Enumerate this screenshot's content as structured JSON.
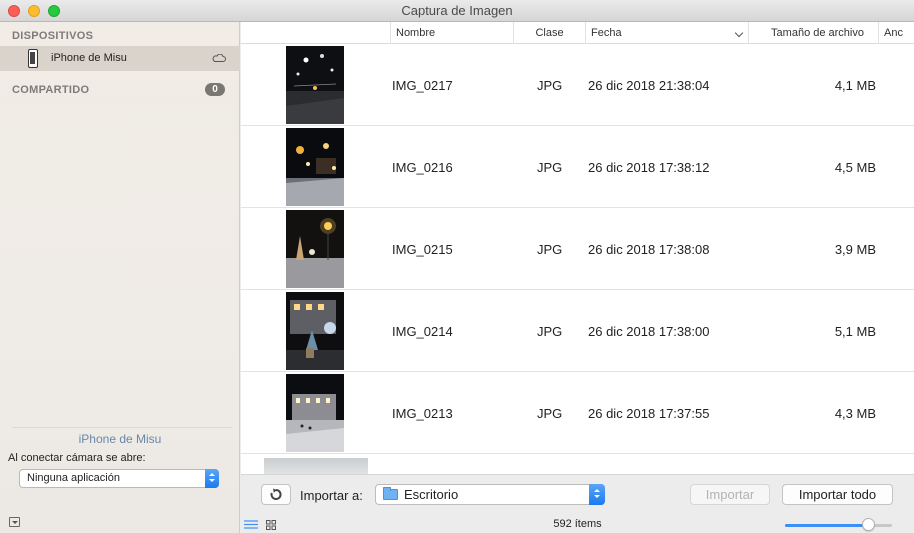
{
  "window": {
    "title": "Captura de Imagen"
  },
  "sidebar": {
    "devices_header": "DISPOSITIVOS",
    "device_name": "iPhone de Misu",
    "shared_header": "COMPARTIDO",
    "shared_count": "0",
    "footer_device_name": "iPhone de Misu",
    "connect_label": "Al conectar cámara se abre:",
    "connect_app": "Ninguna aplicación"
  },
  "table": {
    "columns": {
      "name": "Nombre",
      "kind": "Clase",
      "date": "Fecha",
      "size": "Tamaño de archivo",
      "width": "Anc"
    },
    "rows": [
      {
        "name": "IMG_0217",
        "kind": "JPG",
        "date": "26 dic 2018 21:38:04",
        "size": "4,1 MB"
      },
      {
        "name": "IMG_0216",
        "kind": "JPG",
        "date": "26 dic 2018 17:38:12",
        "size": "4,5 MB"
      },
      {
        "name": "IMG_0215",
        "kind": "JPG",
        "date": "26 dic 2018 17:38:08",
        "size": "3,9 MB"
      },
      {
        "name": "IMG_0214",
        "kind": "JPG",
        "date": "26 dic 2018 17:38:00",
        "size": "5,1 MB"
      },
      {
        "name": "IMG_0213",
        "kind": "JPG",
        "date": "26 dic 2018 17:37:55",
        "size": "4,3 MB"
      }
    ]
  },
  "bottombar": {
    "rotate_icon": "rotate-left-icon",
    "import_to_label": "Importar a:",
    "destination": "Escritorio",
    "import_button": "Importar",
    "import_all_button": "Importar todo",
    "items_count": "592 ítems",
    "thumbnail_size_fraction": 0.78
  },
  "colors": {
    "accent": "#1a7af0",
    "sidebar_selection": "#d9d3cb",
    "close": "#fc5f57",
    "minimize": "#fdbc2e",
    "maximize": "#28c840"
  }
}
